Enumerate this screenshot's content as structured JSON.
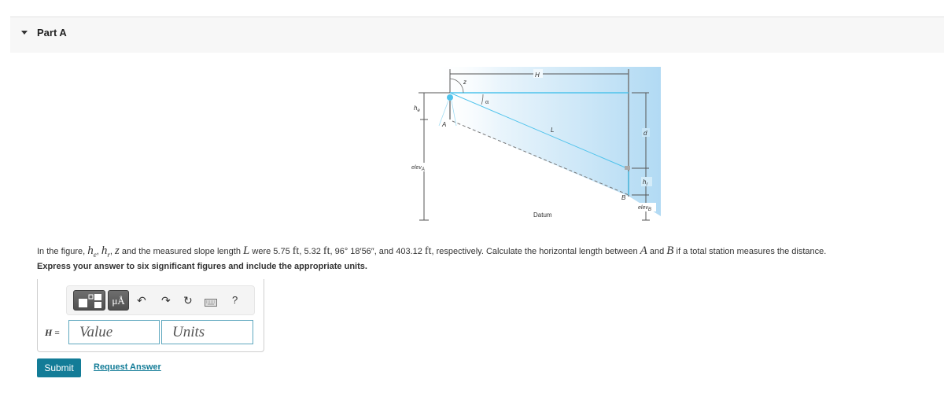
{
  "part": {
    "title": "Part A",
    "expanded": true
  },
  "figure": {
    "labels": {
      "H": "H",
      "z": "z",
      "alpha": "α",
      "he": "h",
      "he_sub": "e",
      "L": "L",
      "d": "d",
      "hr": "h",
      "hr_sub": "r",
      "A": "A",
      "B": "B",
      "elevA": "elev",
      "elevA_sub": "A",
      "elevB": "elev",
      "elevB_sub": "B",
      "datum": "Datum"
    }
  },
  "question": {
    "p1": "In the figure, ",
    "he": "h",
    "he_sub": "e",
    "sep1": ", ",
    "hr": "h",
    "hr_sub": "r",
    "sep2": ", ",
    "z": "z",
    "p2": " and the measured slope length ",
    "L": "L",
    "p3": " were 5.75 ",
    "u1": "ft",
    "p4": ", 5.32 ",
    "u2": "ft",
    "p5": ", 96° 18′56″, and 403.12 ",
    "u3": "ft",
    "p6": ", respectively. Calculate the horizontal length between ",
    "A": "A",
    "p7": " and ",
    "B": "B",
    "p8": " if a total station measures the distance."
  },
  "instruction": "Express your answer to six significant figures and include the appropriate units.",
  "toolbar": {
    "templates_icon": "templates-icon",
    "units_label": "μÅ",
    "undo": "↶",
    "redo": "↷",
    "reset": "↻",
    "keyboard_icon": "keyboard-icon",
    "help": "?"
  },
  "answer": {
    "variable": "H",
    "equals": " =",
    "value_placeholder": "Value",
    "units_placeholder": "Units",
    "value": "",
    "units": ""
  },
  "actions": {
    "submit": "Submit",
    "request_answer": "Request Answer"
  },
  "colors": {
    "accent": "#137c97",
    "input_border": "#5fa8bf",
    "sight_line": "#4fc3ec"
  }
}
